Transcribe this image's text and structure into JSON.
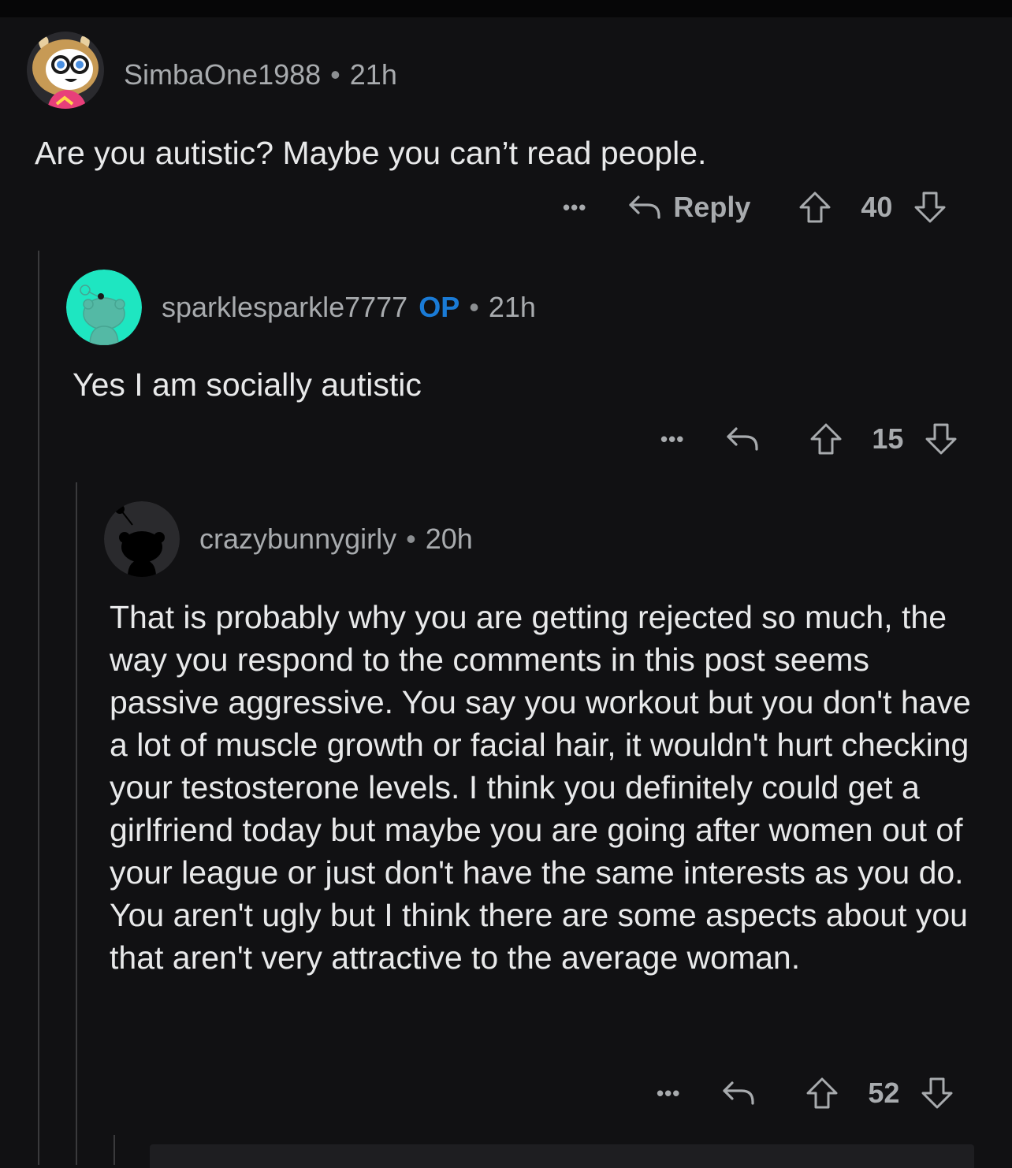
{
  "comments": [
    {
      "username": "SimbaOne1988",
      "time": "21h",
      "body": "Are you autistic? Maybe you can’t read people.",
      "reply_label": "Reply",
      "votes": "40"
    },
    {
      "username": "sparklesparkle7777",
      "op_badge": "OP",
      "time": "21h",
      "body": "Yes I am socially autistic",
      "votes": "15"
    },
    {
      "username": "crazybunnygirly",
      "time": "20h",
      "body": "That is probably why you are getting rejected so much, the way you respond to the comments in this post seems passive aggressive. You say you workout but you don't have a lot of muscle growth or facial hair, it wouldn't hurt checking your testosterone levels. I think you definitely could get a girlfriend today but maybe you are going after women out of your league or just don't have the same interests as you do. You aren't ugly but I think there are some aspects about you that aren't very attractive to the average woman.",
      "votes": "52"
    }
  ],
  "separator": "•",
  "more_label": "•••",
  "colors": {
    "background": "#111113",
    "op_badge": "#1a7bd6",
    "avatar2_bg": "#1ee6c1",
    "thread_line": "#3a3a3c"
  }
}
